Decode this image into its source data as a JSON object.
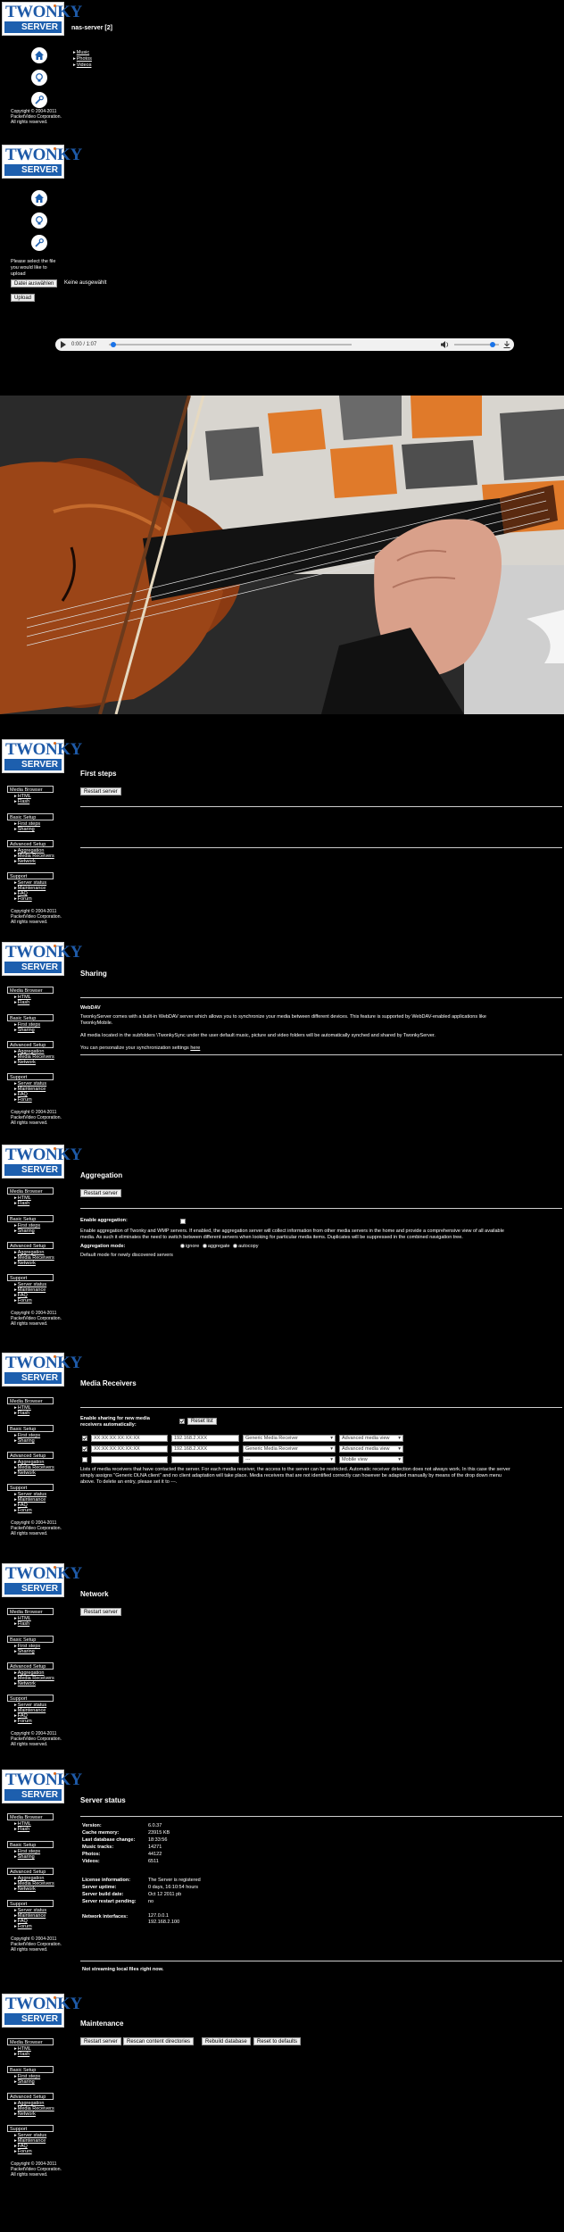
{
  "brand": {
    "twonky": "TWONKY",
    "server": "SERVER"
  },
  "colors": {
    "brand_blue": "#1d5fae",
    "accent_orange": "#e06a1a",
    "background": "#000000"
  },
  "panel1": {
    "title": "nas-server [2]",
    "items": [
      "Music",
      "Photos",
      "Videos"
    ],
    "icons": [
      "home-icon",
      "bulb-icon",
      "wrench-icon"
    ],
    "copyright": [
      "Copyright © 2004-2011",
      "PacketVideo Corporation.",
      "All rights reserved."
    ]
  },
  "panel2": {
    "icons": [
      "home-icon",
      "bulb-icon",
      "wrench-icon"
    ],
    "upload_prompt": [
      "Please select the file",
      "you would like to",
      "upload"
    ],
    "choose_file": "Datei auswählen",
    "no_file": "Keine ausgewählt",
    "upload_button": "Upload"
  },
  "player": {
    "time": "0:00 / 1:07",
    "progress": 0.02,
    "volume": 0.85
  },
  "menu": {
    "media_browser": "Media Browser",
    "mb_items": [
      "HTML",
      "Flash"
    ],
    "basic_setup": "Basic Setup",
    "bs_items": [
      "First steps",
      "Sharing"
    ],
    "advanced_setup": "Advanced Setup",
    "as_items": [
      "Aggregation",
      "Media Receivers",
      "Network"
    ],
    "support": "Support",
    "sp_items": [
      "Server status",
      "Maintenance",
      "FAQ",
      "Forum"
    ],
    "copyright": [
      "Copyright © 2004-2011",
      "PacketVideo Corporation.",
      "All rights reserved."
    ]
  },
  "first_steps": {
    "title": "First steps",
    "restart": "Restart server"
  },
  "sharing": {
    "title": "Sharing",
    "webdav_heading": "WebDAV",
    "webdav_text1": "TwonkyServer comes with a built-in WebDAV server which allows you to synchronize your media between different devices. This feature is supported by WebDAV-enabled applications like",
    "webdav_text2": "TwonkyMobile.",
    "webdav_text3": "All media located in the subfolders \\TwonkySync under the user default music, picture and video folders will be automatically synched and shared by TwonkyServer.",
    "webdav_text4": "You can personalize your synchronization settings",
    "webdav_link": "here"
  },
  "aggregation": {
    "title": "Aggregation",
    "restart": "Restart server",
    "enable_label": "Enable aggregation:",
    "desc1": "Enable aggregation of Twonky and WMP servers. If enabled, the aggregation server will collect information from other media servers in the home and provide a comprehensive view of all available",
    "desc2": "media. As such it eliminates the need to switch between different servers when looking for particular media items. Duplicates will be suppressed in the combined navigation tree.",
    "mode_label": "Aggregation mode:",
    "mode_ignore": "ignore",
    "mode_aggregate": "aggregate",
    "mode_autocopy": "autocopy",
    "default_mode": "Default mode for newly discovered servers"
  },
  "media_receivers": {
    "title": "Media Receivers",
    "enable_label": [
      "Enable sharing for new media",
      "receivers automatically:"
    ],
    "reset_button": "Reset list",
    "rows": [
      {
        "mac": "XX:XX:XX:XX:XX:XX",
        "ip": "192.168.2.XXX",
        "type": "Generic Media Receiver",
        "view": "Advanced media view"
      },
      {
        "mac": "XX:XX:XX:XX:XX:XX",
        "ip": "192.168.2.XXX",
        "type": "Generic Media Receiver",
        "view": "Advanced media view"
      },
      {
        "mac": "",
        "ip": "",
        "type": "---",
        "view": "Mobile view"
      }
    ],
    "desc1": "Lists of media receivers that have contacted the server. For each media receiver, the access to the server can be restricted. Automatic receiver detection does not always work. In this case the server",
    "desc2": "simply assigns \"Generic DLNA client\" and no client adaptation will take place. Media receivers that are not identified correctly can however be adapted manually by means of the drop down menu",
    "desc3": "above. To delete an entry, please set it to ---."
  },
  "network": {
    "title": "Network",
    "restart": "Restart server"
  },
  "server_status": {
    "title": "Server status",
    "rows1": [
      {
        "label": "Version:",
        "value": "6.0.37"
      },
      {
        "label": "Cache memory:",
        "value": "23915 KB"
      },
      {
        "label": "Last database change:",
        "value": "18:33:56"
      },
      {
        "label": "Music tracks:",
        "value": "14271"
      },
      {
        "label": "Photos:",
        "value": "44122"
      },
      {
        "label": "Videos:",
        "value": "6511"
      }
    ],
    "rows2": [
      {
        "label": "License information:",
        "value": "The Server is registered"
      },
      {
        "label": "Server uptime:",
        "value": "0 days, 16:10:54 hours"
      },
      {
        "label": "Server build date:",
        "value": "Oct 12 2011 pb"
      },
      {
        "label": "Server restart pending:",
        "value": "no"
      }
    ],
    "network_label": "Network interfaces:",
    "network_values": [
      "127.0.0.1",
      "192.168.2.100"
    ],
    "streaming": "Not streaming local files right now."
  },
  "maintenance": {
    "title": "Maintenance",
    "buttons": [
      "Restart server",
      "Rescan content directories",
      "Rebuild database",
      "Reset to defaults"
    ]
  }
}
